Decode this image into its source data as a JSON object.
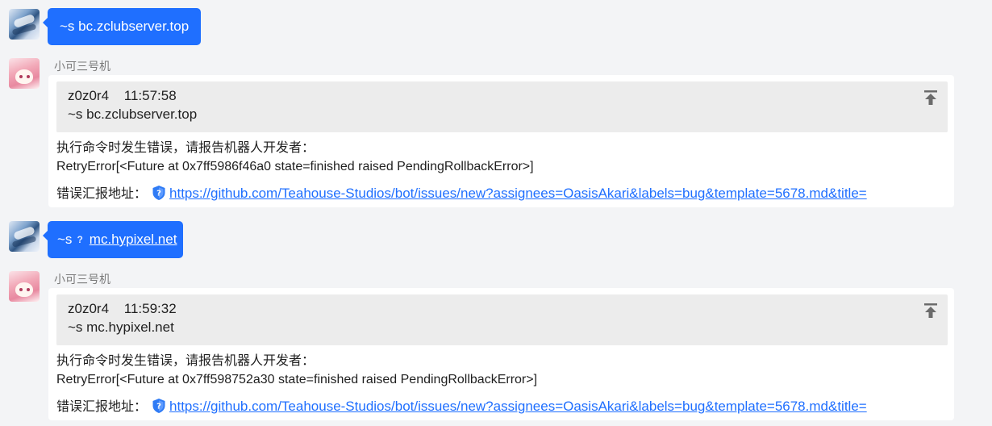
{
  "messages": [
    {
      "user_command": "~s bc.zclubserver.top"
    },
    {
      "sender": "小可三号机",
      "quote": {
        "sender": "z0z0r4",
        "time": "11:57:58",
        "text": "~s bc.zclubserver.top"
      },
      "error_intro": "执行命令时发生错误，请报告机器人开发者：",
      "error_detail": "RetryError[<Future at 0x7ff5986f46a0 state=finished raised PendingRollbackError>]",
      "report_label": "错误汇报地址：",
      "report_url": "https://github.com/Teahouse-Studios/bot/issues/new?assignees=OasisAkari&labels=bug&template=5678.md&title="
    },
    {
      "user_command_prefix": "~s",
      "user_command_link": "mc.hypixel.net"
    },
    {
      "sender": "小可三号机",
      "quote": {
        "sender": "z0z0r4",
        "time": "11:59:32",
        "text": "~s mc.hypixel.net"
      },
      "error_intro": "执行命令时发生错误，请报告机器人开发者：",
      "error_detail": "RetryError[<Future at 0x7ff598752a30 state=finished raised PendingRollbackError>]",
      "report_label": "错误汇报地址：",
      "report_url": "https://github.com/Teahouse-Studios/bot/issues/new?assignees=OasisAkari&labels=bug&template=5678.md&title="
    }
  ],
  "colors": {
    "background": "#f3f4f6",
    "user_bubble": "#1f6fff",
    "link": "#1f6fff",
    "quote_bg": "#ececec",
    "sender_name": "#7a7a7a"
  },
  "icons": [
    "user-avatar",
    "bot-avatar",
    "question-icon",
    "jump-to-top-icon",
    "shield-icon"
  ]
}
